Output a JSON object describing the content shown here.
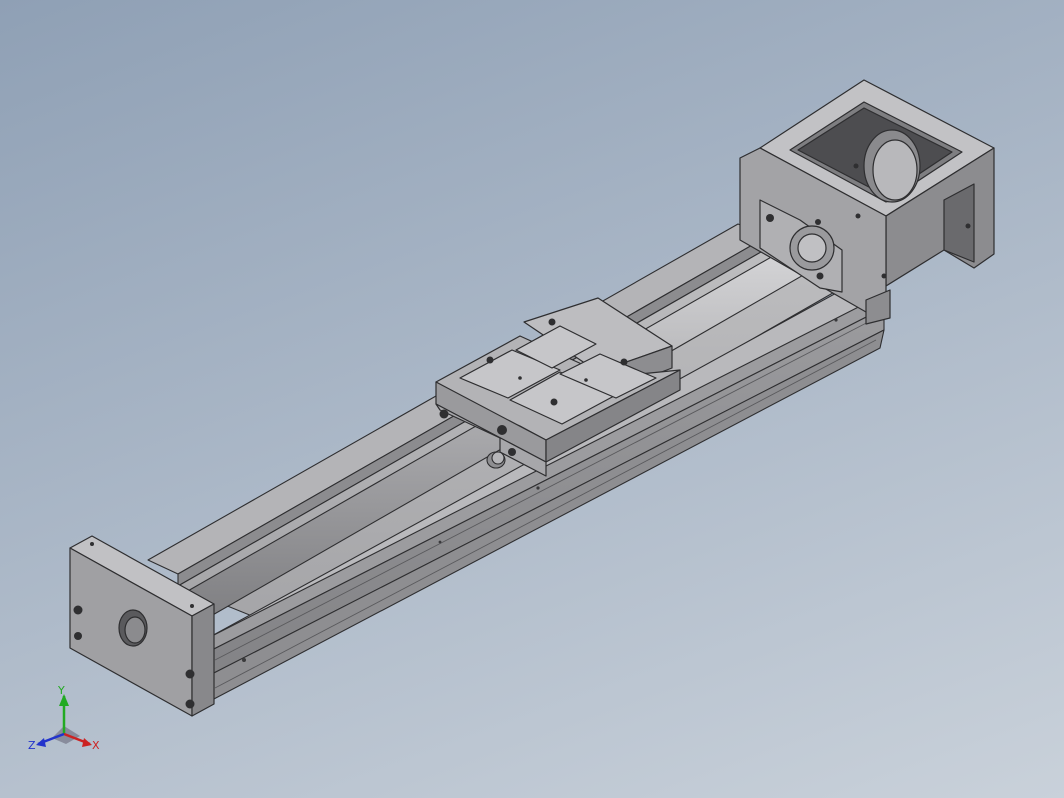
{
  "viewport": {
    "background_colors": [
      "#8fa0b5",
      "#c9d1da"
    ],
    "model": "linear-actuator-module",
    "part_color": "#a9a9ab"
  },
  "triad": {
    "x_label": "X",
    "y_label": "Y",
    "z_label": "Z",
    "x_color": "#cc2222",
    "y_color": "#22aa22",
    "z_color": "#2233cc"
  }
}
